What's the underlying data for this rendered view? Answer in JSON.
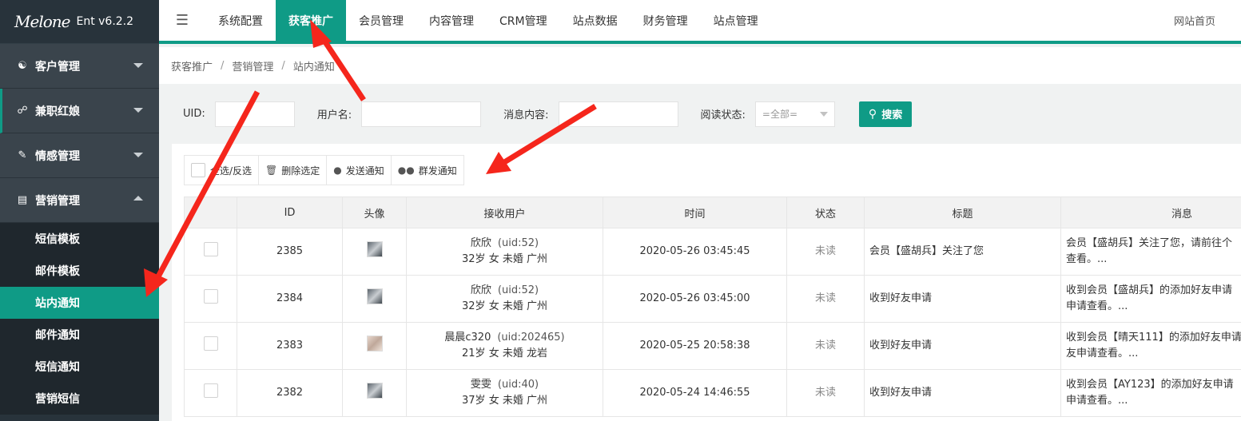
{
  "logo": {
    "script": "Melone",
    "version": "Ent v6.2.2"
  },
  "sidebar": {
    "groups": [
      {
        "label": "客户管理",
        "icon": "users-icon",
        "caret": "down"
      },
      {
        "label": "兼职红娘",
        "icon": "matchmaker-icon",
        "caret": "down"
      },
      {
        "label": "情感管理",
        "icon": "emotion-icon",
        "caret": "down"
      },
      {
        "label": "营销管理",
        "icon": "chart-icon",
        "caret": "up"
      }
    ],
    "sub_items": [
      {
        "label": "短信模板"
      },
      {
        "label": "邮件模板"
      },
      {
        "label": "站内通知",
        "selected": true
      },
      {
        "label": "邮件通知"
      },
      {
        "label": "短信通知"
      },
      {
        "label": "营销短信"
      }
    ]
  },
  "topnav": {
    "items": [
      "系统配置",
      "获客推广",
      "会员管理",
      "内容管理",
      "CRM管理",
      "站点数据",
      "财务管理",
      "站点管理"
    ],
    "active": "获客推广",
    "right_link": "网站首页"
  },
  "breadcrumb": [
    "获客推广",
    "营销管理",
    "站内通知"
  ],
  "filter": {
    "uid_label": "UID:",
    "uid_value": "",
    "username_label": "用户名:",
    "username_value": "",
    "message_label": "消息内容:",
    "message_value": "",
    "read_status_label": "阅读状态:",
    "read_status_value": "=全部=",
    "search_button": "搜索"
  },
  "toolbar": {
    "select_all": "全选/反选",
    "delete_selected": "删除选定",
    "send_notice": "发送通知",
    "group_notice": "群发通知"
  },
  "table": {
    "columns": [
      "",
      "ID",
      "头像",
      "接收用户",
      "时间",
      "状态",
      "标题",
      "消息"
    ],
    "rows": [
      {
        "id": "2385",
        "user": "欣欣",
        "uid": "(uid:52)",
        "info": "32岁 女 未婚 广州",
        "time": "2020-05-26 03:45:45",
        "status": "未读",
        "title": "会员【盛胡兵】关注了您",
        "msg1": "会员【盛胡兵】关注了您，请前往个",
        "msg2": "查看。...",
        "avatar": "dark"
      },
      {
        "id": "2384",
        "user": "欣欣",
        "uid": "(uid:52)",
        "info": "32岁 女 未婚 广州",
        "time": "2020-05-26 03:45:00",
        "status": "未读",
        "title": "收到好友申请",
        "msg1": "收到会员【盛胡兵】的添加好友申请",
        "msg2": "申请查看。...",
        "avatar": "dark"
      },
      {
        "id": "2383",
        "user": "晨晨c320",
        "uid": "(uid:202465)",
        "info": "21岁 女 未婚 龙岩",
        "time": "2020-05-25 20:58:38",
        "status": "未读",
        "title": "收到好友申请",
        "msg1": "收到会员【晴天111】的添加好友申请",
        "msg2": "友申请查看。...",
        "avatar": "light"
      },
      {
        "id": "2382",
        "user": "雯雯",
        "uid": "(uid:40)",
        "info": "37岁 女 未婚 广州",
        "time": "2020-05-24 14:46:55",
        "status": "未读",
        "title": "收到好友申请",
        "msg1": "收到会员【AY123】的添加好友申请",
        "msg2": "申请查看。...",
        "avatar": "dark"
      }
    ]
  },
  "colors": {
    "accent": "#0f9b86",
    "sidebar_bg": "#28333b",
    "annotation": "#f5261c"
  }
}
